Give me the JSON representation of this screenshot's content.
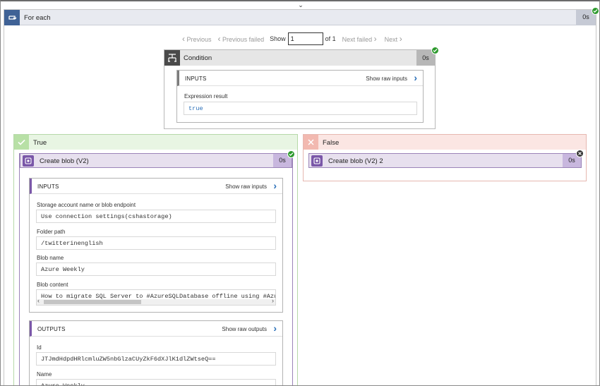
{
  "foreach": {
    "title": "For each",
    "duration": "0s"
  },
  "pager": {
    "previous": "Previous",
    "previous_failed": "Previous failed",
    "show": "Show",
    "current": "1",
    "of": "of 1",
    "next_failed": "Next failed",
    "next": "Next"
  },
  "condition": {
    "title": "Condition",
    "duration": "0s",
    "inputs_label": "INPUTS",
    "show_raw": "Show raw inputs",
    "expr_label": "Expression result",
    "expr_value": "true"
  },
  "true_branch": {
    "title": "True",
    "action": {
      "title": "Create blob (V2)",
      "duration": "0s",
      "inputs": {
        "label": "INPUTS",
        "show_raw": "Show raw inputs",
        "fields": [
          {
            "label": "Storage account name or blob endpoint",
            "value": "Use connection settings(cshastorage)"
          },
          {
            "label": "Folder path",
            "value": "/twitterinenglish"
          },
          {
            "label": "Blob name",
            "value": "Azure Weekly"
          },
          {
            "label": "Blob content",
            "value": "How to migrate SQL Server to #AzureSQLDatabase offline using #Azure"
          }
        ]
      },
      "outputs": {
        "label": "OUTPUTS",
        "show_raw": "Show raw outputs",
        "fields": [
          {
            "label": "Id",
            "value": "JTJmdHdpdHRlcmluZW5nbGlzaCUyZkF6dXJlK1dlZWtseQ=="
          },
          {
            "label": "Name",
            "value": "Azure Weekly"
          }
        ]
      }
    }
  },
  "false_branch": {
    "title": "False",
    "action": {
      "title": "Create blob (V2) 2",
      "duration": "0s"
    }
  },
  "colors": {
    "success": "#2e9a2e",
    "true_bg": "#e8f5e3",
    "false_bg": "#fbe6e3",
    "accent_blue": "#3f6296",
    "purple": "#7a57a8"
  }
}
